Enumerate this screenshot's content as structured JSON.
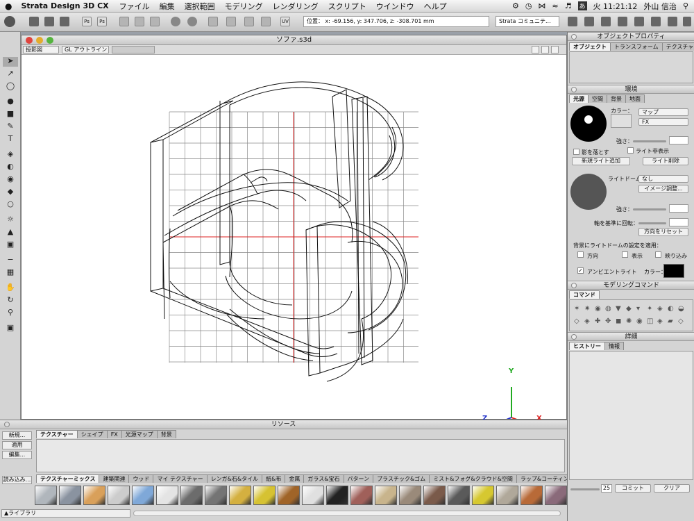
{
  "menubar": {
    "apple": "",
    "app_name": "Strata Design 3D CX",
    "items": [
      "ファイル",
      "編集",
      "選択範囲",
      "モデリング",
      "レンダリング",
      "スクリプト",
      "ウインドウ",
      "ヘルプ"
    ],
    "clock": "火 11:21:12",
    "user": "外山 信治",
    "input_mode": "あ"
  },
  "toolbar": {
    "ps1": "Ps",
    "ps2": "Ps",
    "uv": "UV",
    "coordinates": "位置： x: -69.156, y: 347.706, z: -308.701 mm",
    "community": "Strata コミュニテ..."
  },
  "document": {
    "title": "ソファ.s3d",
    "projection": "投影図",
    "render_mode": "GL アウトライン"
  },
  "axes": {
    "x": "X",
    "y": "Y",
    "z": "Z"
  },
  "resources": {
    "title": "リソース",
    "tabs": [
      "テクスチャー",
      "シェイプ",
      "FX",
      "光源マップ",
      "背景"
    ],
    "buttons": [
      "新規...",
      "適用",
      "編集..."
    ],
    "import": "読み込み...",
    "category_tabs": [
      "テクスチャーミックス",
      "建築関連",
      "ウッド",
      "マイ テクスチャー",
      "レンガ&石&タイル",
      "紙&布",
      "金属",
      "ガラス&宝石",
      "パターン",
      "プラスチック&ゴム",
      "ミスト&フォグ&クラウド&空間",
      "ラップ&コーティング"
    ],
    "library": "▲ライブラリ",
    "swatch_colors": [
      "#b0b6bc",
      "#8a93a0",
      "#d9a05a",
      "#cccccc",
      "#7fa8d8",
      "#e4e4e4",
      "#6c6c6c",
      "#747474",
      "#d4b040",
      "#d6c232",
      "#a06428",
      "#e0e0e0",
      "#222222",
      "#a0605a",
      "#c8b48c",
      "#9a8a7a",
      "#7a5a4a",
      "#5a5a5a",
      "#d6c830",
      "#b0a89a",
      "#b86a38",
      "#8a6a7a"
    ]
  },
  "object_props": {
    "title": "オブジェクトプロパティ",
    "tabs": [
      "オブジェクト",
      "トランスフォーム",
      "テクスチャー"
    ]
  },
  "environment": {
    "title": "環境",
    "tabs": [
      "光源",
      "空間",
      "背景",
      "地面"
    ],
    "color_label": "カラー：",
    "map_select": "マップ",
    "fx_select": "FX",
    "strength_label": "強さ：",
    "shadow_checkbox": "影を落とす",
    "light_hidden_checkbox": "ライト非表示",
    "add_light": "新規ライト追加",
    "delete_light": "ライト削除",
    "light_dome_label": "ライトドーム：",
    "light_dome_value": "なし",
    "image_adjust": "イメージ調整...",
    "strength_label2": "強さ：",
    "rotate_axis_label": "軸を基準に回転：",
    "reset_direction": "方向をリセット",
    "apply_to_background": "背景にライトドームの設定を適用：",
    "direction_chk": "方向",
    "display_chk": "表示",
    "reflect_chk": "映り込み",
    "ambient_label": "アンビエントライト",
    "ambient_color_label": "カラー："
  },
  "modeling": {
    "title": "モデリングコマンド",
    "tab": "コマンド"
  },
  "details": {
    "title": "詳細",
    "tabs": [
      "ヒストリー",
      "情報"
    ],
    "history_count": "25",
    "commit": "コミット",
    "clear": "クリア"
  },
  "colors": {
    "grid": "#8a8a8a",
    "axis_red": "#dd2222",
    "axis_green": "#22aa22",
    "axis_blue": "#2233cc"
  }
}
